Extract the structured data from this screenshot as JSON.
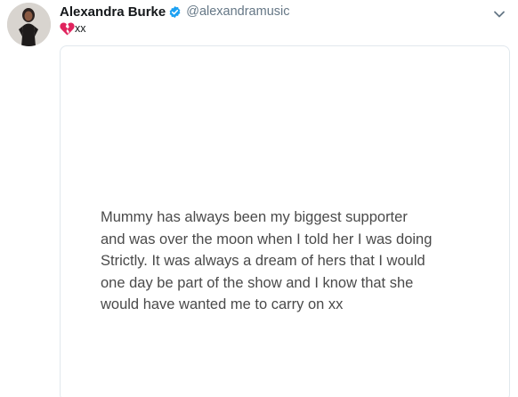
{
  "tweet": {
    "author": {
      "display_name": "Alexandra Burke",
      "handle": "@alexandramusic",
      "verified": true
    },
    "text": "xx",
    "emoji_icon": "broken-heart-icon",
    "media": {
      "note_text": "Mummy has always been my biggest supporter\nand was over the moon when I told her I was doing\nStrictly. It was always a dream of hers that I would\none day be part of the show and I know that she\nwould have wanted me to carry on xx"
    }
  },
  "colors": {
    "verified_badge": "#1da1f2",
    "broken_heart": "#e0245e",
    "name_text": "#14171a",
    "handle_text": "#657786",
    "card_border": "#e1e8ed",
    "note_text": "#4a4a4a"
  }
}
